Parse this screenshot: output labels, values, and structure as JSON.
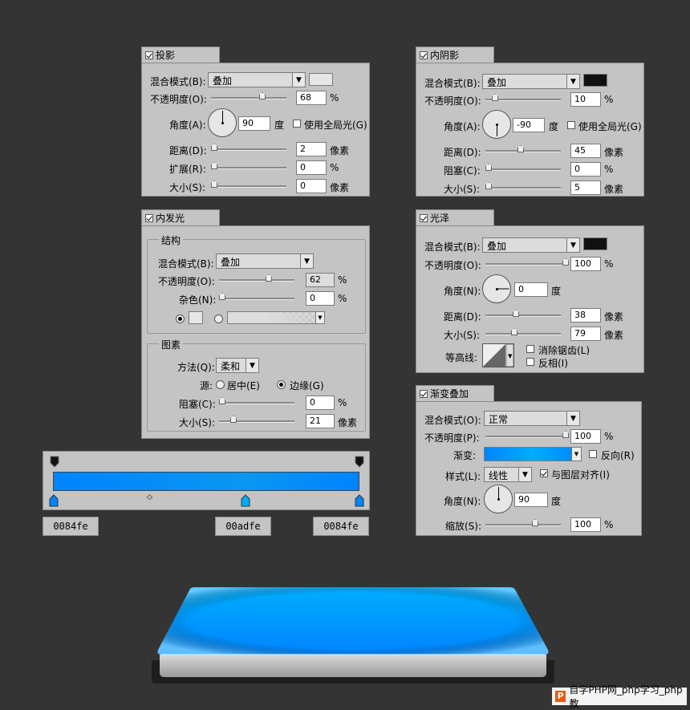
{
  "drop_shadow": {
    "tab": "投影",
    "blend_label": "混合模式(B):",
    "blend_value": "叠加",
    "opacity_label": "不透明度(O):",
    "opacity_value": "68",
    "pct": "%",
    "angle_label": "角度(A):",
    "angle_value": "90",
    "deg": "度",
    "global_light": "使用全局光(G)",
    "distance_label": "距离(D):",
    "distance_value": "2",
    "px": "像素",
    "spread_label": "扩展(R):",
    "spread_value": "0",
    "size_label": "大小(S):",
    "size_value": "0",
    "color": "#e6e6e6"
  },
  "inner_shadow": {
    "tab": "内阴影",
    "blend_label": "混合模式(B):",
    "blend_value": "叠加",
    "opacity_label": "不透明度(O):",
    "opacity_value": "10",
    "pct": "%",
    "angle_label": "角度(A):",
    "angle_value": "-90",
    "deg": "度",
    "global_light": "使用全局光(G)",
    "distance_label": "距离(D):",
    "distance_value": "45",
    "px": "像素",
    "choke_label": "阻塞(C):",
    "choke_value": "0",
    "size_label": "大小(S):",
    "size_value": "5",
    "color": "#111111"
  },
  "inner_glow": {
    "tab": "内发光",
    "structure_title": "结构",
    "blend_label": "混合模式(B):",
    "blend_value": "叠加",
    "opacity_label": "不透明度(O):",
    "opacity_value": "62",
    "pct": "%",
    "noise_label": "杂色(N):",
    "noise_value": "0",
    "elements_title": "图素",
    "technique_label": "方法(Q):",
    "technique_value": "柔和",
    "source_label": "源:",
    "source_center": "居中(E)",
    "source_edge": "边缘(G)",
    "choke_label": "阻塞(C):",
    "choke_value": "0",
    "size_label": "大小(S):",
    "size_value": "21",
    "px": "像素"
  },
  "satin": {
    "tab": "光泽",
    "blend_label": "混合模式(B):",
    "blend_value": "叠加",
    "opacity_label": "不透明度(O):",
    "opacity_value": "100",
    "pct": "%",
    "angle_label": "角度(N):",
    "angle_value": "0",
    "deg": "度",
    "distance_label": "距离(D):",
    "distance_value": "38",
    "px": "像素",
    "size_label": "大小(S):",
    "size_value": "79",
    "contour_label": "等高线:",
    "antialias": "消除锯齿(L)",
    "invert": "反相(I)",
    "color": "#111111"
  },
  "gradient_overlay": {
    "tab": "渐变叠加",
    "blend_label": "混合模式(O):",
    "blend_value": "正常",
    "opacity_label": "不透明度(P):",
    "opacity_value": "100",
    "pct": "%",
    "gradient_label": "渐变:",
    "reverse": "反向(R)",
    "style_label": "样式(L):",
    "style_value": "线性",
    "align": "与图层对齐(I)",
    "angle_label": "角度(N):",
    "angle_value": "90",
    "deg": "度",
    "scale_label": "缩放(S):",
    "scale_value": "100"
  },
  "gradient_editor": {
    "stops": [
      "0084fe",
      "00adfe",
      "0084fe"
    ],
    "color_a": "#0084fe",
    "color_b": "#00adfe"
  },
  "watermark": {
    "text": "自学PHP网_php学习_php教"
  }
}
